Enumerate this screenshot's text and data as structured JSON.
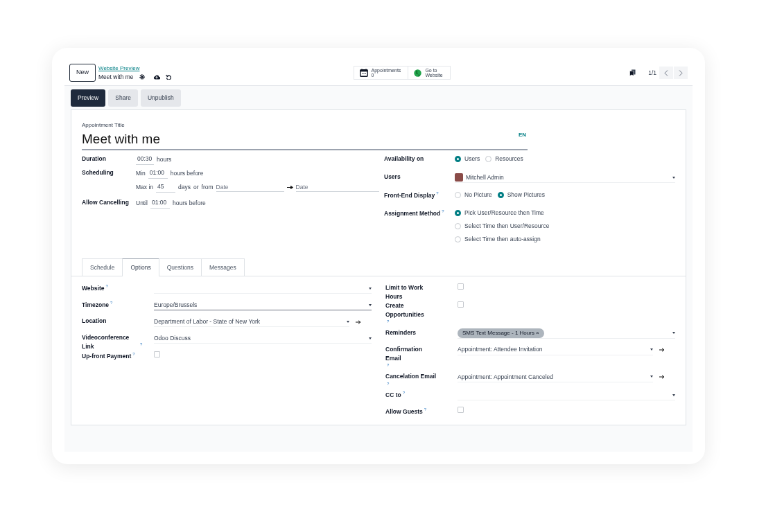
{
  "control_panel": {
    "new_button": "New",
    "breadcrumb": "Website Preview",
    "record_title": "Meet with me",
    "smart_buttons": [
      {
        "kind": "calendar",
        "label": "Appointments",
        "value": "0"
      },
      {
        "kind": "globe",
        "label": "Go to",
        "value": "Website"
      }
    ],
    "pager": "1/1"
  },
  "header_buttons": [
    {
      "label": "Preview",
      "primary": true
    },
    {
      "label": "Share",
      "primary": false
    },
    {
      "label": "Unpublish",
      "primary": false
    }
  ],
  "title": {
    "label": "Appointment Title",
    "value": "Meet with me",
    "lang": "EN"
  },
  "duration": {
    "label": "Duration",
    "value": "00:30",
    "unit": "hours"
  },
  "scheduling": {
    "label": "Scheduling",
    "min_prefix": "Min",
    "min_value": "01:00",
    "min_unit": "hours before",
    "max_prefix": "Max in",
    "max_value": "45",
    "max_unit": "days",
    "or": "or",
    "from": "from",
    "start_placeholder": "Date",
    "end_placeholder": "Date"
  },
  "allow_cancelling": {
    "label": "Allow Cancelling",
    "prefix": "Until",
    "value": "01:00",
    "unit": "hours before"
  },
  "availability_on": {
    "label": "Availability on",
    "inline": true,
    "options": [
      {
        "label": "Users",
        "selected": true
      },
      {
        "label": "Resources",
        "selected": false
      }
    ]
  },
  "users": {
    "label": "Users",
    "tags": [
      {
        "name": "Mitchell Admin"
      }
    ]
  },
  "front_end_display": {
    "label": "Front-End Display",
    "help": "?",
    "inline": true,
    "options": [
      {
        "label": "No Picture",
        "selected": false
      },
      {
        "label": "Show Pictures",
        "selected": true
      }
    ]
  },
  "assignment_method": {
    "label": "Assignment Method",
    "help": "?",
    "inline": false,
    "options": [
      {
        "label": "Pick User/Resource then Time",
        "selected": true
      },
      {
        "label": "Select Time then User/Resource",
        "selected": false
      },
      {
        "label": "Select Time then auto-assign",
        "selected": false
      }
    ]
  },
  "tabs": [
    {
      "label": "Schedule",
      "selected": false
    },
    {
      "label": "Options",
      "selected": true
    },
    {
      "label": "Questions",
      "selected": false
    },
    {
      "label": "Messages",
      "selected": false
    }
  ],
  "options_left": [
    {
      "kind": "select",
      "label": "Website",
      "help": "?"
    },
    {
      "kind": "select",
      "label": "Timezone",
      "help": "?",
      "value": "Europe/Brussels",
      "focused": true
    },
    {
      "kind": "link",
      "label": "Location",
      "value": "Department of Labor - State of New York"
    },
    {
      "kind": "select",
      "label": "Videoconference Link",
      "help": "?",
      "value": "Odoo Discuss"
    },
    {
      "kind": "checkbox",
      "label": "Up-front Payment",
      "help": "?",
      "checked": false
    }
  ],
  "options_right": [
    {
      "kind": "checkbox",
      "label": "Limit to Work Hours",
      "checked": false
    },
    {
      "kind": "checkbox",
      "label": "Create Opportunities",
      "help": "?",
      "checked": false
    },
    {
      "kind": "tags",
      "label": "Reminders",
      "tags": [
        {
          "label": "SMS Text Message - 1 Hours",
          "remove": "×"
        }
      ]
    },
    {
      "kind": "link",
      "label": "Confirmation Email",
      "help": "?",
      "value": "Appointment: Attendee Invitation"
    },
    {
      "kind": "link",
      "label": "Cancelation Email",
      "help": "?",
      "value": "Appointment: Appointment Canceled"
    },
    {
      "kind": "select",
      "label": "CC to",
      "help": "?"
    },
    {
      "kind": "checkbox",
      "label": "Allow Guests",
      "help": "?",
      "checked": false
    }
  ]
}
